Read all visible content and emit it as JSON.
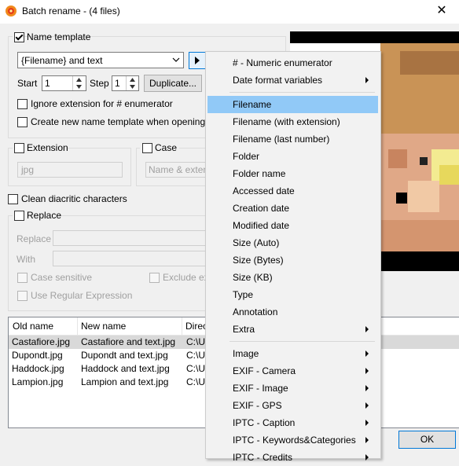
{
  "window": {
    "title": "Batch rename - (4 files)",
    "close_glyph": "✕"
  },
  "name_template": {
    "label": "Name template",
    "value": "{Filename} and text",
    "start_label": "Start",
    "start_value": "1",
    "step_label": "Step",
    "step_value": "1",
    "duplicate_label": "Duplicate...",
    "ignore_ext_label": "Ignore extension for # enumerator",
    "create_new_label": "Create new name template when opening dialo"
  },
  "extension": {
    "label": "Extension",
    "value": "jpg"
  },
  "case": {
    "label": "Case",
    "value": "Name & extens"
  },
  "clean_label": "Clean diacritic characters",
  "replace": {
    "label": "Replace",
    "replace_label": "Replace",
    "with_label": "With",
    "case_sensitive_label": "Case sensitive",
    "exclude_label": "Exclude ext",
    "regex_label": "Use Regular Expression"
  },
  "list": {
    "columns": [
      "Old name",
      "New name",
      "Direc"
    ],
    "rows": [
      {
        "old": "Castafiore.jpg",
        "new": "Castafiore and text.jpg",
        "dir": "C:\\U"
      },
      {
        "old": "Dupondt.jpg",
        "new": "Dupondt and text.jpg",
        "dir": "C:\\U"
      },
      {
        "old": "Haddock.jpg",
        "new": "Haddock and text.jpg",
        "dir": "C:\\U"
      },
      {
        "old": "Lampion.jpg",
        "new": "Lampion and text.jpg",
        "dir": "C:\\U"
      }
    ]
  },
  "ok_label": "OK",
  "menu": {
    "items": [
      {
        "label": "# - Numeric enumerator",
        "sub": false
      },
      {
        "label": "Date format variables",
        "sub": true
      },
      {
        "label": "Filename",
        "sub": false
      },
      {
        "label": "Filename (with extension)",
        "sub": false
      },
      {
        "label": "Filename (last number)",
        "sub": false
      },
      {
        "label": "Folder",
        "sub": false
      },
      {
        "label": "Folder name",
        "sub": false
      },
      {
        "label": "Accessed date",
        "sub": false
      },
      {
        "label": "Creation date",
        "sub": false
      },
      {
        "label": "Modified date",
        "sub": false
      },
      {
        "label": "Size (Auto)",
        "sub": false
      },
      {
        "label": "Size (Bytes)",
        "sub": false
      },
      {
        "label": "Size (KB)",
        "sub": false
      },
      {
        "label": "Type",
        "sub": false
      },
      {
        "label": "Annotation",
        "sub": false
      },
      {
        "label": "Extra",
        "sub": true
      },
      {
        "label": "Image",
        "sub": true
      },
      {
        "label": "EXIF - Camera",
        "sub": true
      },
      {
        "label": "EXIF - Image",
        "sub": true
      },
      {
        "label": "EXIF - GPS",
        "sub": true
      },
      {
        "label": "IPTC - Caption",
        "sub": true
      },
      {
        "label": "IPTC - Keywords&Categories",
        "sub": true
      },
      {
        "label": "IPTC - Credits",
        "sub": true
      }
    ]
  },
  "colors": {
    "highlight": "#91c9f7",
    "selected_row": "#d9d9d9",
    "ok_border": "#0078d7"
  }
}
